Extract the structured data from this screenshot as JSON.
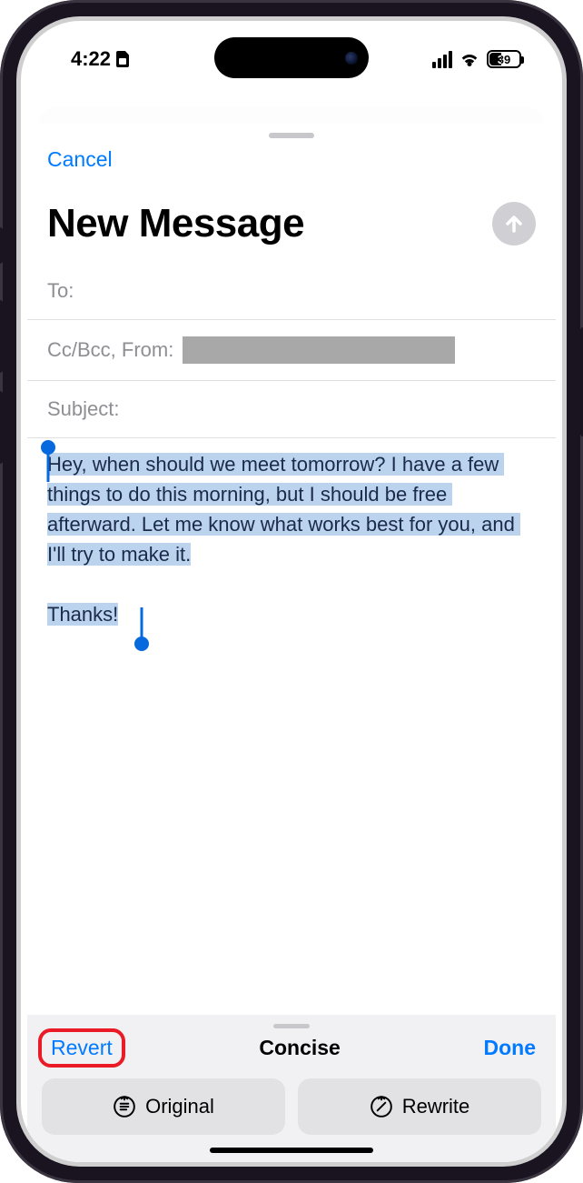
{
  "status": {
    "time": "4:22",
    "battery": "39"
  },
  "sheet": {
    "cancel": "Cancel",
    "title": "New Message",
    "fields": {
      "to_label": "To:",
      "cc_label": "Cc/Bcc, From:",
      "subject_label": "Subject:"
    },
    "body_main": "Hey, when should we meet tomorrow? I have a few things to do this morning, but I should be free afterward. Let me know what works best for you, and I'll try to make it.",
    "body_thanks": "Thanks!"
  },
  "toolbar": {
    "revert": "Revert",
    "mode": "Concise",
    "done": "Done",
    "original": "Original",
    "rewrite": "Rewrite"
  }
}
